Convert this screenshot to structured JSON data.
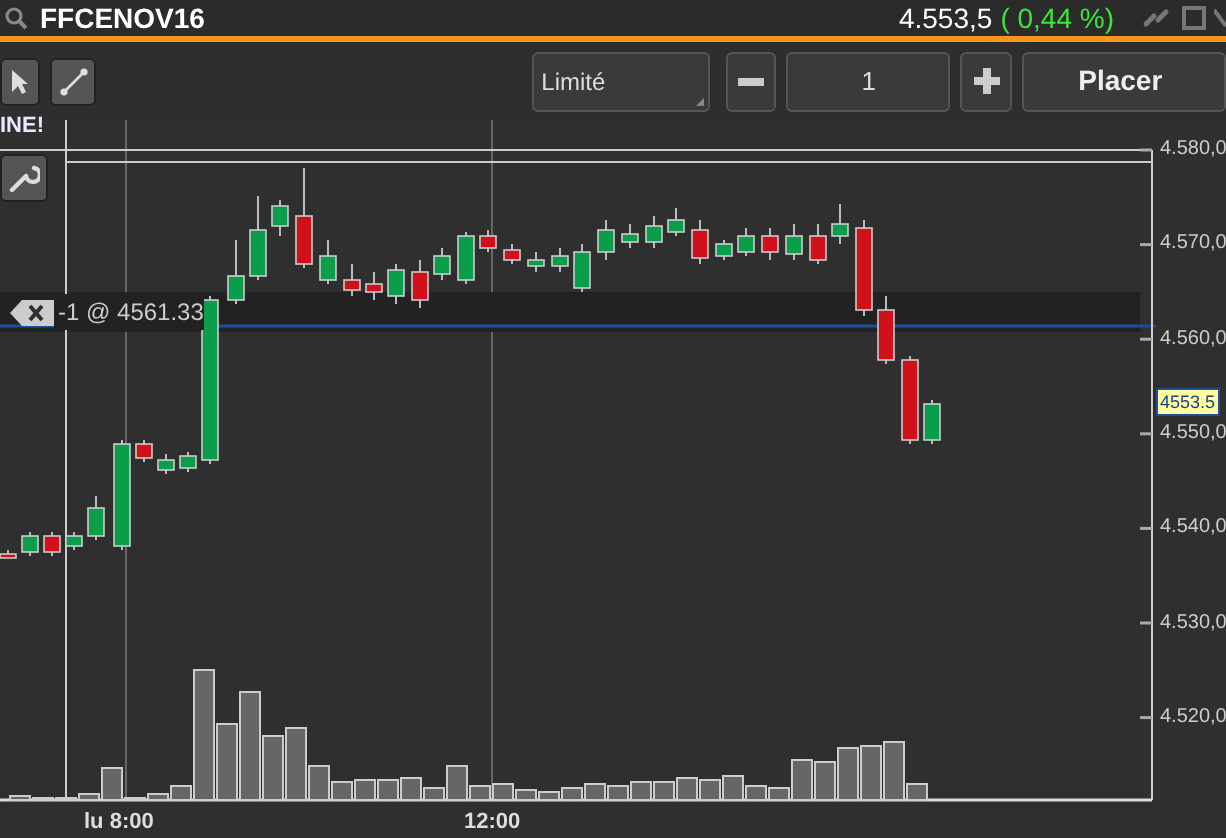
{
  "header": {
    "symbol": "FFCENOV16",
    "price": "4.553,5",
    "change": "( 0,44 %)"
  },
  "toolbar": {
    "order_type": "Limité",
    "quantity": "1",
    "place_button": "Placer"
  },
  "chart": {
    "notice": "INE!",
    "order_line": "-1 @ 4561.33",
    "last_price": "4553.5",
    "price_labels": [
      "4.580,0",
      "4.570,0",
      "4.560,0",
      "4.550,0",
      "4.540,0",
      "4.530,0",
      "4.520,0"
    ],
    "time_labels": [
      "lu 8:00",
      "12:00"
    ]
  }
}
